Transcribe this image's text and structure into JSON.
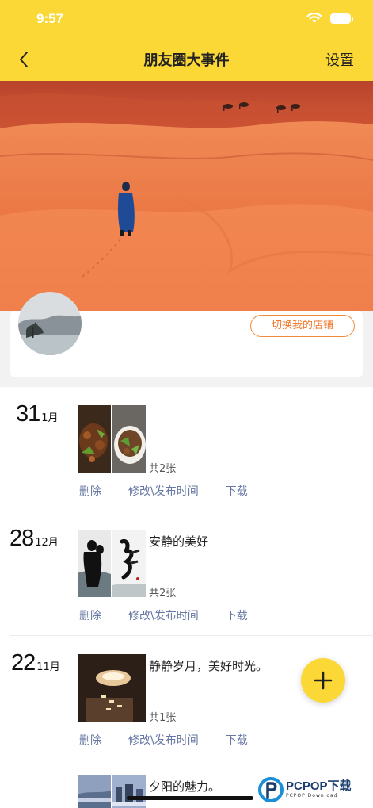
{
  "status_bar": {
    "time": "9:57"
  },
  "nav": {
    "title": "朋友圈大事件",
    "settings_label": "设置"
  },
  "profile": {
    "switch_store_label": "切换我的店铺"
  },
  "posts": [
    {
      "day": "31",
      "month": "1月",
      "caption": "",
      "count": "共2张",
      "actions": [
        "删除",
        "修改\\发布时间",
        "下载"
      ]
    },
    {
      "day": "28",
      "month": "12月",
      "caption": "安静的美好",
      "count": "共2张",
      "actions": [
        "删除",
        "修改\\发布时间",
        "下载"
      ]
    },
    {
      "day": "22",
      "month": "11月",
      "caption": "静静岁月，美好时光。",
      "count": "共1张",
      "actions": [
        "删除",
        "修改\\发布时间",
        "下载"
      ]
    },
    {
      "caption": "夕阳的魅力。"
    }
  ],
  "fab": {
    "icon": "plus-icon"
  },
  "watermark": {
    "main": "PCPOP下载",
    "sub": "PCPOP Download"
  },
  "colors": {
    "accent": "#fbd836",
    "switch_border": "#f08a3a",
    "action_text": "#6677a3"
  }
}
